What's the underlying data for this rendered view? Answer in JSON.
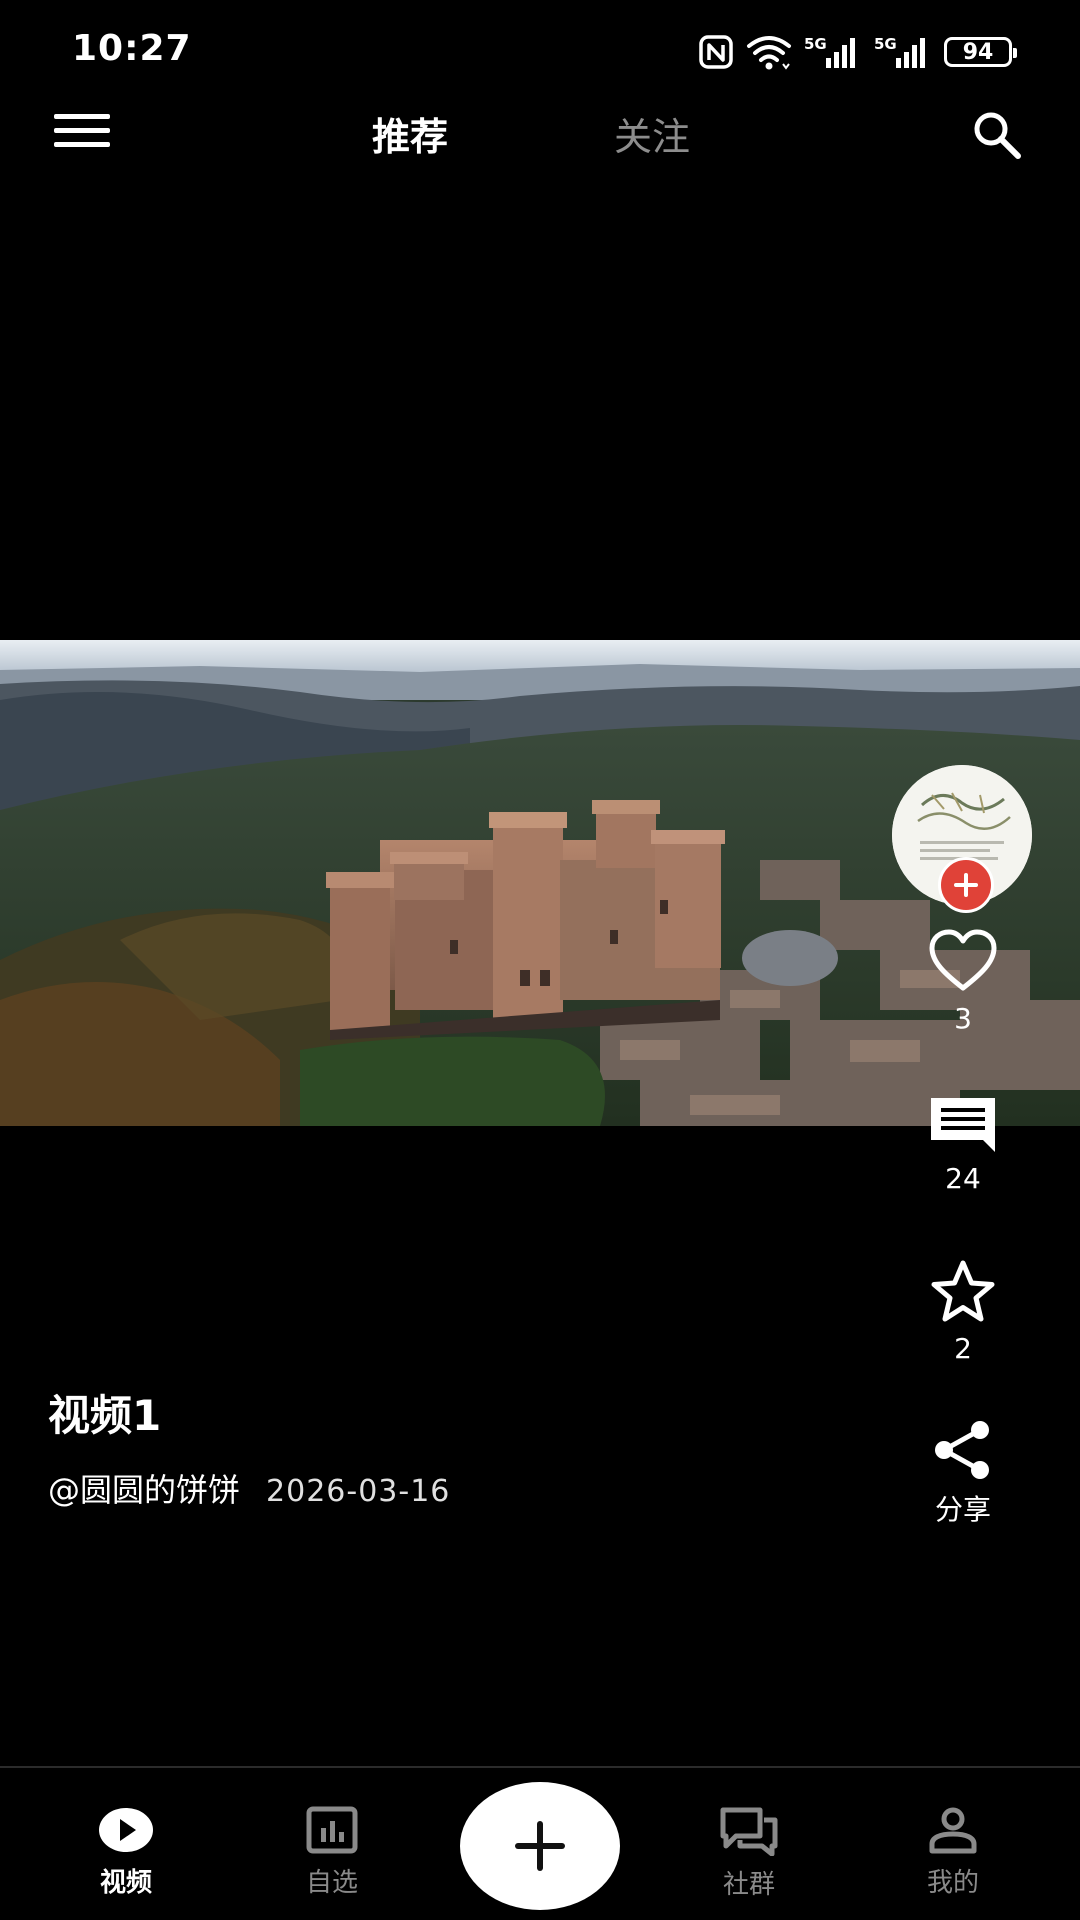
{
  "status_bar": {
    "time": "10:27",
    "battery": "94",
    "network_1": "5G",
    "network_2": "5G"
  },
  "top_nav": {
    "tabs": [
      {
        "label": "推荐",
        "active": true
      },
      {
        "label": "关注",
        "active": false
      }
    ]
  },
  "video": {
    "title": "视频1",
    "author": "@圆圆的饼饼",
    "date": "2026-03-16"
  },
  "actions": {
    "likes": "3",
    "comments": "24",
    "favorites": "2",
    "share_label": "分享"
  },
  "bottom_nav": {
    "items": [
      {
        "label": "视频",
        "active": true
      },
      {
        "label": "自选",
        "active": false
      },
      {
        "label": "社群",
        "active": false
      },
      {
        "label": "我的",
        "active": false
      }
    ]
  },
  "colors": {
    "background": "#000000",
    "follow_badge": "#e04238",
    "inactive_text": "#8a8a8a"
  }
}
